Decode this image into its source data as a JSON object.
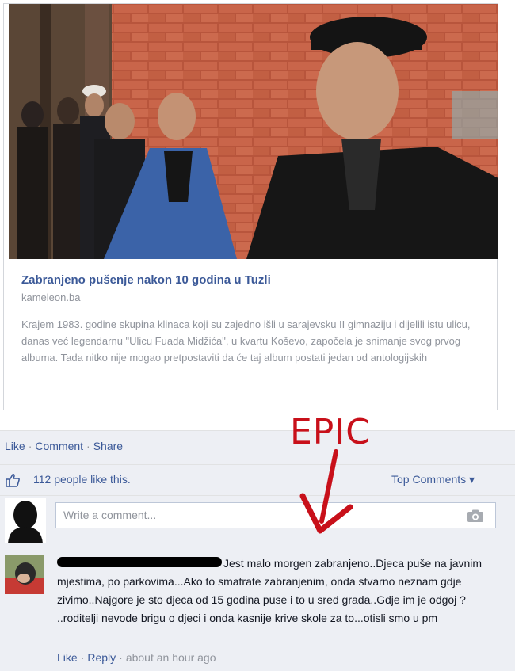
{
  "post": {
    "link_title": "Zabranjeno pušenje nakon 10 godina u Tuzli",
    "link_domain": "kameleon.ba",
    "link_description": "Krajem 1983. godine skupina klinaca koji su zajedno išli u sarajevsku II gimnaziju i dijelili istu ulicu, danas već legendarnu \"Ulicu Fuada Midžića\", u kvartu Koševo, započela je snimanje svog prvog albuma. Tada nitko nije mogao pretpostaviti da će taj album postati jedan od antologijskih"
  },
  "actions": {
    "like": "Like",
    "comment": "Comment",
    "share": "Share",
    "separator": "·"
  },
  "likes": {
    "text": "112 people like this.",
    "sort": "Top Comments ▾"
  },
  "comment_box": {
    "placeholder": "Write a comment..."
  },
  "comment": {
    "text": "Jest malo morgen zabranjeno..Djeca puše na javnim mjestima, po parkovima...Ako to smatrate zabranjenim, onda stvarno neznam gdje zivimo..Najgore je sto djeca od 15 godina puse i to u sred grada..Gdje im je odgoj ? ..roditelji nevode brigu o djeci i onda kasnije krive skole za to...otisli smo u pm",
    "like": "Like",
    "reply": "Reply",
    "time": "about an hour ago"
  },
  "annotation": {
    "text": "EPIC",
    "color": "#c8101a"
  },
  "icons": {
    "like": "thumbs-up-icon",
    "camera": "camera-icon",
    "arrow": "arrow-down-icon"
  }
}
